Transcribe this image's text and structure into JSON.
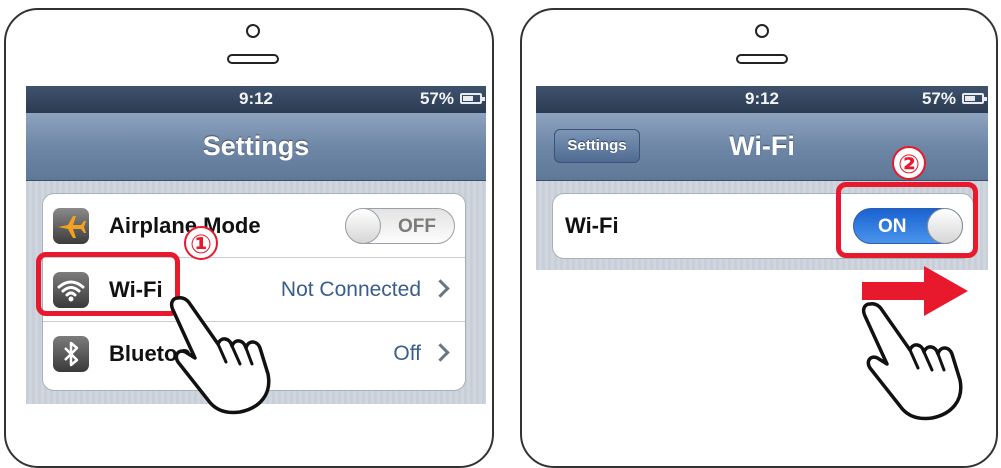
{
  "left_screen": {
    "status": {
      "time": "9:12",
      "battery": "57%"
    },
    "nav_title": "Settings",
    "rows": [
      {
        "icon": "airplane-icon",
        "label": "Airplane Mode",
        "toggle": "OFF"
      },
      {
        "icon": "wifi-icon",
        "label": "Wi-Fi",
        "value": "Not Connected"
      },
      {
        "icon": "bluetooth-icon",
        "label": "Bluetooth",
        "value": "Off"
      }
    ],
    "step_marker": "①"
  },
  "right_screen": {
    "status": {
      "time": "9:12",
      "battery": "57%"
    },
    "nav_back": "Settings",
    "nav_title": "Wi-Fi",
    "row": {
      "label": "Wi-Fi",
      "toggle": "ON"
    },
    "step_marker": "②"
  },
  "colors": {
    "highlight": "#e8192c",
    "toggle_on": "#1a62cf",
    "value_text": "#3a5d8f",
    "status_bar": "#2b3b52",
    "nav_bar": "#6f87a7"
  }
}
